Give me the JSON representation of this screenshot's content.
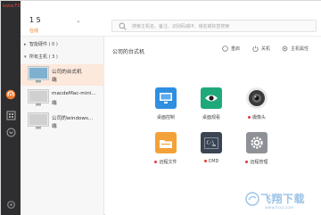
{
  "watermark_top": "www.FXXZ.com",
  "header": {
    "user_name": "1           5",
    "user_status": "在线",
    "search_placeholder": "搜索主机名、备注、识别码或IP、域名或标签搜索"
  },
  "device_list": {
    "groups": [
      {
        "label": "智能硬件 ( 0 )"
      },
      {
        "label": "所有主机 ( 3 )"
      }
    ],
    "devices": [
      {
        "name": "公司的台式机",
        "suffix": "端",
        "active": true
      },
      {
        "name": "macdeMac-mini...",
        "suffix": "端",
        "active": false
      },
      {
        "name": "公司的windows...",
        "suffix": "端",
        "active": false
      }
    ]
  },
  "main": {
    "title": "公司的台式机",
    "actions": {
      "restart": "重启",
      "shutdown": "关机",
      "host_attr": "主机属性"
    },
    "tiles": [
      {
        "label": "桌面控制",
        "dot": false
      },
      {
        "label": "桌面观看",
        "dot": false
      },
      {
        "label": "摄像头",
        "dot": true
      },
      {
        "label": "远程文件",
        "dot": true
      },
      {
        "label": "CMD",
        "dot": true
      },
      {
        "label": "远程管理",
        "dot": true
      }
    ]
  },
  "brand": {
    "text": "飞翔下载",
    "url": "www.fxxz.com"
  },
  "colors": {
    "rail": "#2e2e30",
    "accent": "#f07a2c",
    "active_row": "#fde8dc"
  }
}
